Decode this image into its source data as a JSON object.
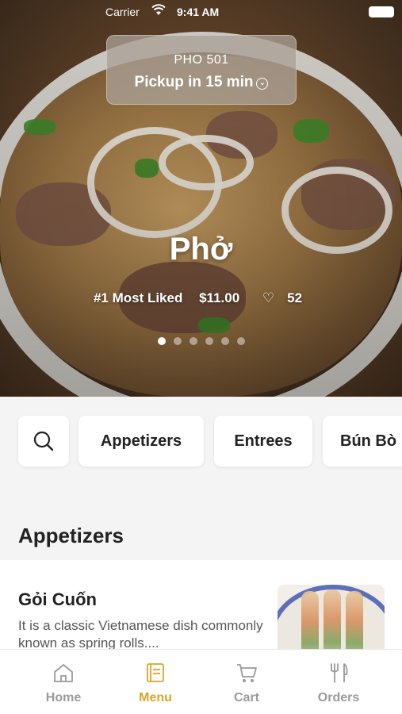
{
  "status_bar": {
    "carrier": "Carrier",
    "time": "9:41 AM"
  },
  "restaurant": {
    "name": "PHO 501",
    "pickup_label": "Pickup in 15 min"
  },
  "featured": {
    "title": "Phở",
    "rank": "#1 Most Liked",
    "price": "$11.00",
    "likes": "52",
    "carousel": {
      "count": 6,
      "active": 1
    }
  },
  "categories": [
    "Appetizers",
    "Entrees",
    "Bún Bò"
  ],
  "section": {
    "title": "Appetizers"
  },
  "items": [
    {
      "name": "Gỏi Cuốn",
      "description": "It is a classic Vietnamese dish commonly known as spring rolls...."
    }
  ],
  "tabs": [
    {
      "label": "Home",
      "icon": "home-icon",
      "active": false
    },
    {
      "label": "Menu",
      "icon": "menu-book-icon",
      "active": true
    },
    {
      "label": "Cart",
      "icon": "cart-icon",
      "active": false
    },
    {
      "label": "Orders",
      "icon": "fork-knife-icon",
      "active": false
    }
  ],
  "colors": {
    "accent": "#d8a52b",
    "inactive": "#9a9a9a",
    "background": "#f4f4f4"
  }
}
